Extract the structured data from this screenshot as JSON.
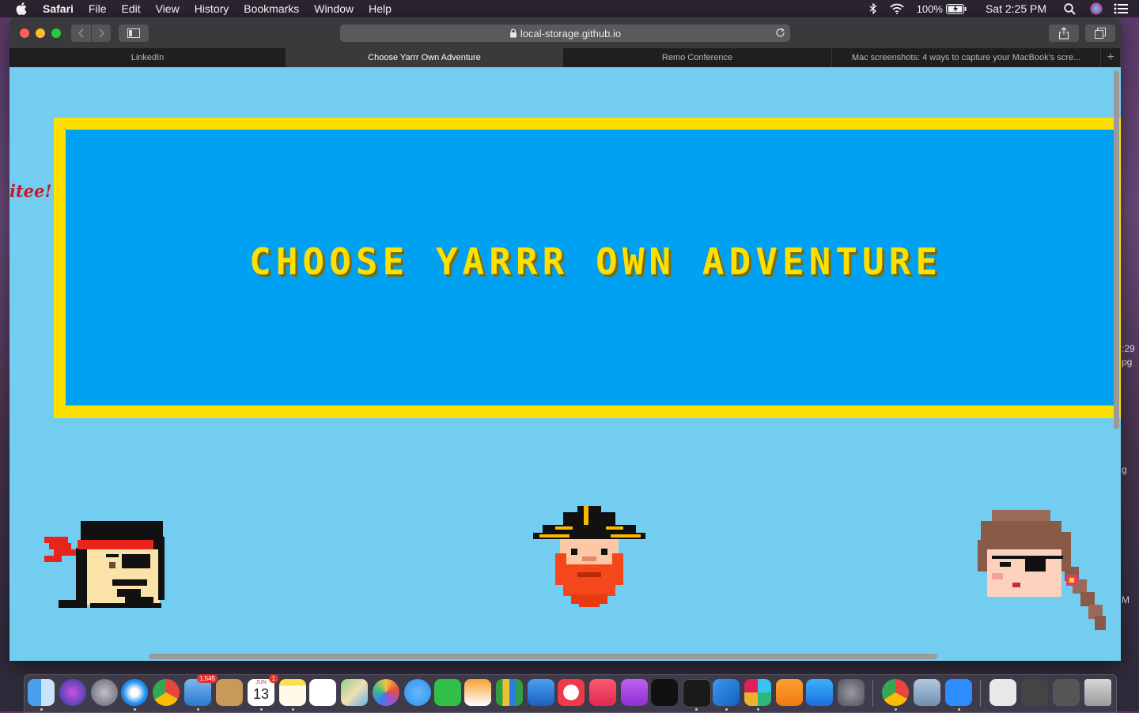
{
  "menubar": {
    "app_name": "Safari",
    "menus": [
      "File",
      "Edit",
      "View",
      "History",
      "Bookmarks",
      "Window",
      "Help"
    ],
    "battery": "100%",
    "clock": "Sat 2:25 PM"
  },
  "browser": {
    "url": "local-storage.github.io",
    "tabs": [
      {
        "label": "LinkedIn",
        "active": false
      },
      {
        "label": "Choose Yarrr Own Adventure",
        "active": true
      },
      {
        "label": "Remo Conference",
        "active": false
      },
      {
        "label": "Mac screenshots: 4 ways to capture your MacBook's scre...",
        "active": false
      }
    ]
  },
  "page": {
    "banner_title": "CHOOSE YARRR OWN ADVENTURE",
    "side_fragment": "itee!",
    "colors": {
      "background": "#72cdf0",
      "banner_border": "#fbe000",
      "banner_fill": "#00a0f3",
      "title": "#fbe000"
    },
    "characters": [
      "bandana-pirate",
      "captain-pirate",
      "eyepatch-pirate"
    ]
  },
  "desktop": {
    "edge_labels": [
      ":29",
      "pg",
      "g",
      "M"
    ]
  },
  "dock": {
    "badges": {
      "mail": "1,545",
      "calendar": "1"
    },
    "calendar_day": "13",
    "calendar_month": "JUN"
  }
}
